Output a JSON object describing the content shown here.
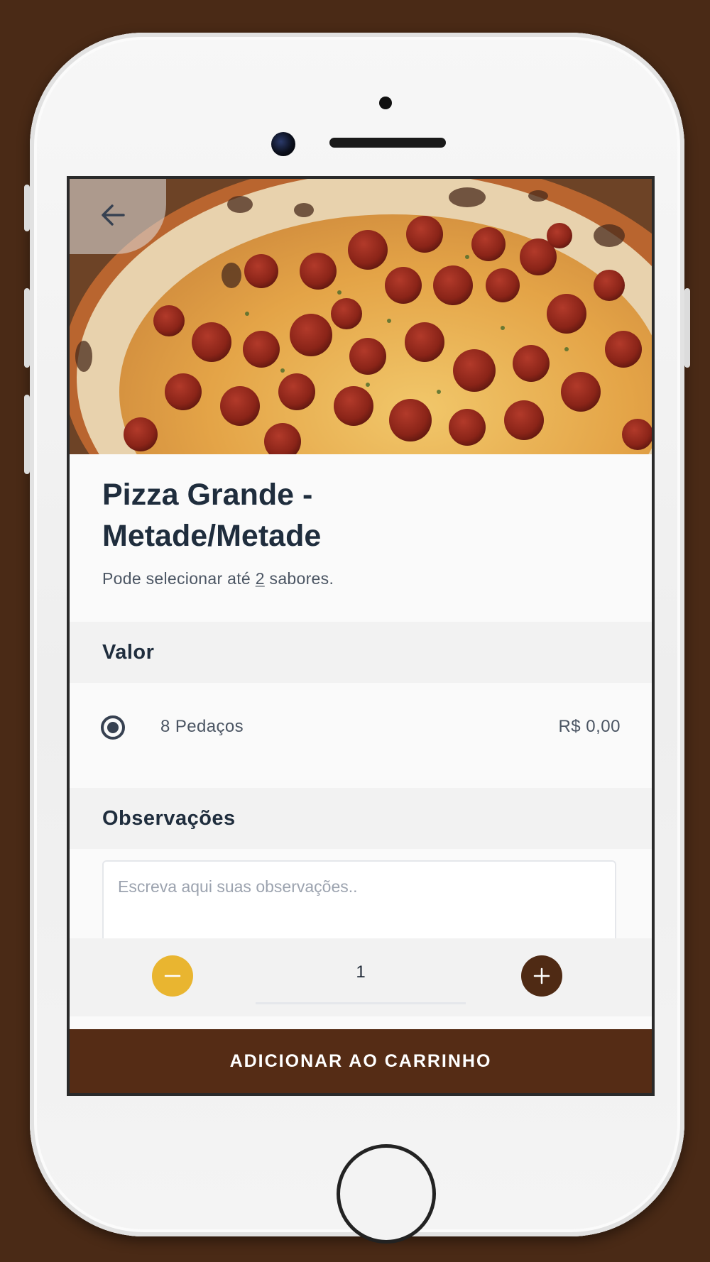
{
  "product": {
    "title_line1": "Pizza Grande -",
    "title_line2": "Metade/Metade",
    "subtitle_prefix": "Pode selecionar até",
    "subtitle_number": "2",
    "subtitle_suffix": "sabores."
  },
  "sections": {
    "value_header": "Valor",
    "notes_header": "Observações"
  },
  "options": [
    {
      "label": "8 Pedaços",
      "price": "R$ 0,00",
      "selected": true
    }
  ],
  "notes": {
    "placeholder": "Escreva aqui suas observações..",
    "value": ""
  },
  "quantity": {
    "value": "1"
  },
  "cart_button": {
    "label": "ADICIONAR AO CARRINHO"
  },
  "icons": {
    "back": "arrow-left-icon",
    "minus": "minus-icon",
    "plus": "plus-icon"
  },
  "colors": {
    "background": "#4a2a16",
    "accent_brown": "#552c15",
    "minus_yellow": "#e9b530",
    "text_dark": "#1f2d3d"
  }
}
